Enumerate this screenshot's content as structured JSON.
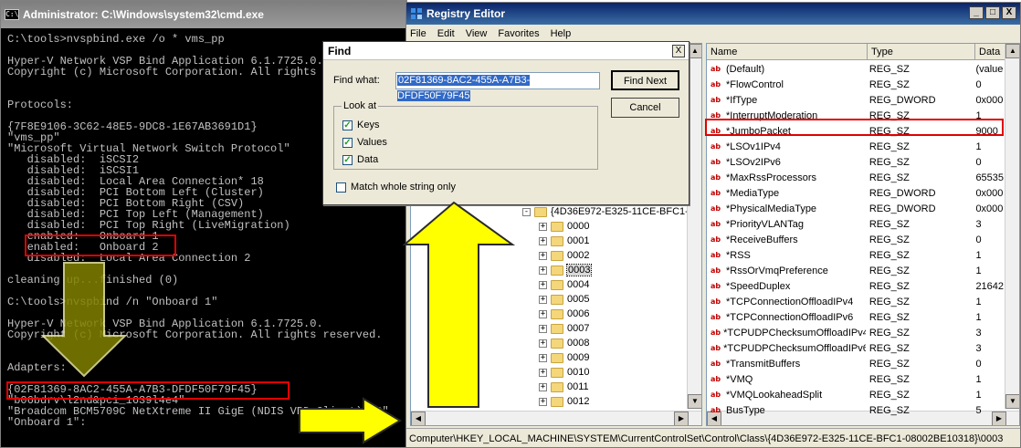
{
  "cmd": {
    "title": "Administrator: C:\\Windows\\system32\\cmd.exe",
    "icon_text": "C:\\",
    "lines": [
      "C:\\tools>nvspbind.exe /o * vms_pp",
      "",
      "Hyper-V Network VSP Bind Application 6.1.7725.0.",
      "Copyright (c) Microsoft Corporation. All rights reserved.",
      "",
      "",
      "Protocols:",
      "",
      "{7F8E9106-3C62-48E5-9DC8-1E67AB3691D1}",
      "\"vms_pp\"",
      "\"Microsoft Virtual Network Switch Protocol\"",
      "   disabled:  iSCSI2",
      "   disabled:  iSCSI1",
      "   disabled:  Local Area Connection* 18",
      "   disabled:  PCI Bottom Left (Cluster)",
      "   disabled:  PCI Bottom Right (CSV)",
      "   disabled:  PCI Top Left (Management)",
      "   disabled:  PCI Top Right (LiveMigration)",
      "   enabled:   Onboard 1",
      "   enabled:   Onboard 2",
      "   disabled:  Local Area Connection 2",
      "",
      "cleaning up...finished (0)",
      "",
      "C:\\tools>nvspbind /n \"Onboard 1\"",
      "",
      "Hyper-V Network VSP Bind Application 6.1.7725.0.",
      "Copyright (c) Microsoft Corporation. All rights reserved.",
      "",
      "",
      "Adapters:",
      "",
      "{02F81369-8AC2-455A-A7B3-DFDF50F79F45}",
      "\"b06bdrv\\l2nd&pci_1639l4e4\"",
      "\"Broadcom BCM5709C NetXtreme II GigE (NDIS VBD Client) #2\"",
      "\"Onboard 1\":"
    ]
  },
  "regedit": {
    "title": "Registry Editor",
    "window_buttons": [
      "_",
      "□",
      "X"
    ],
    "menu": [
      "File",
      "Edit",
      "View",
      "Favorites",
      "Help"
    ],
    "tree": {
      "parent": "{4D36E972-E325-11CE-BFC1-",
      "expander_plus": "+",
      "expander_minus": "-",
      "children": [
        "0000",
        "0001",
        "0002",
        "0003",
        "0004",
        "0005",
        "0006",
        "0007",
        "0008",
        "0009",
        "0010",
        "0011",
        "0012"
      ],
      "selected": "0003"
    },
    "columns": {
      "name": "Name",
      "type": "Type",
      "data": "Data"
    },
    "value_icon": "ab",
    "values": [
      {
        "name": "(Default)",
        "type": "REG_SZ",
        "data": "(value"
      },
      {
        "name": "*FlowControl",
        "type": "REG_SZ",
        "data": "0"
      },
      {
        "name": "*IfType",
        "type": "REG_DWORD",
        "data": "0x000"
      },
      {
        "name": "*InterruptModeration",
        "type": "REG_SZ",
        "data": "1"
      },
      {
        "name": "*JumboPacket",
        "type": "REG_SZ",
        "data": "9000"
      },
      {
        "name": "*LSOv1IPv4",
        "type": "REG_SZ",
        "data": "1"
      },
      {
        "name": "*LSOv2IPv6",
        "type": "REG_SZ",
        "data": "0"
      },
      {
        "name": "*MaxRssProcessors",
        "type": "REG_SZ",
        "data": "65535"
      },
      {
        "name": "*MediaType",
        "type": "REG_DWORD",
        "data": "0x000"
      },
      {
        "name": "*PhysicalMediaType",
        "type": "REG_DWORD",
        "data": "0x000"
      },
      {
        "name": "*PriorityVLANTag",
        "type": "REG_SZ",
        "data": "3"
      },
      {
        "name": "*ReceiveBuffers",
        "type": "REG_SZ",
        "data": "0"
      },
      {
        "name": "*RSS",
        "type": "REG_SZ",
        "data": "1"
      },
      {
        "name": "*RssOrVmqPreference",
        "type": "REG_SZ",
        "data": "1"
      },
      {
        "name": "*SpeedDuplex",
        "type": "REG_SZ",
        "data": "21642"
      },
      {
        "name": "*TCPConnectionOffloadIPv4",
        "type": "REG_SZ",
        "data": "1"
      },
      {
        "name": "*TCPConnectionOffloadIPv6",
        "type": "REG_SZ",
        "data": "1"
      },
      {
        "name": "*TCPUDPChecksumOffloadIPv4",
        "type": "REG_SZ",
        "data": "3"
      },
      {
        "name": "*TCPUDPChecksumOffloadIPv6",
        "type": "REG_SZ",
        "data": "3"
      },
      {
        "name": "*TransmitBuffers",
        "type": "REG_SZ",
        "data": "0"
      },
      {
        "name": "*VMQ",
        "type": "REG_SZ",
        "data": "1"
      },
      {
        "name": "*VMQLookaheadSplit",
        "type": "REG_SZ",
        "data": "1"
      },
      {
        "name": "BusType",
        "type": "REG_SZ",
        "data": "5"
      }
    ],
    "status": "Computer\\HKEY_LOCAL_MACHINE\\SYSTEM\\CurrentControlSet\\Control\\Class\\{4D36E972-E325-11CE-BFC1-08002BE10318}\\0003"
  },
  "find_dialog": {
    "title": "Find",
    "close": "X",
    "find_what_label": "Find what:",
    "find_what_value": "02F81369-8AC2-455A-A7B3-DFDF50F79F45",
    "find_next": "Find Next",
    "cancel": "Cancel",
    "look_at": "Look at",
    "check_mark": "✓",
    "keys": "Keys",
    "values": "Values",
    "data": "Data",
    "match_whole": "Match whole string only"
  },
  "colors": {
    "highlight": "#e00000",
    "arrow_yellow": "#ffff00",
    "arrow_olive": "#808000"
  }
}
